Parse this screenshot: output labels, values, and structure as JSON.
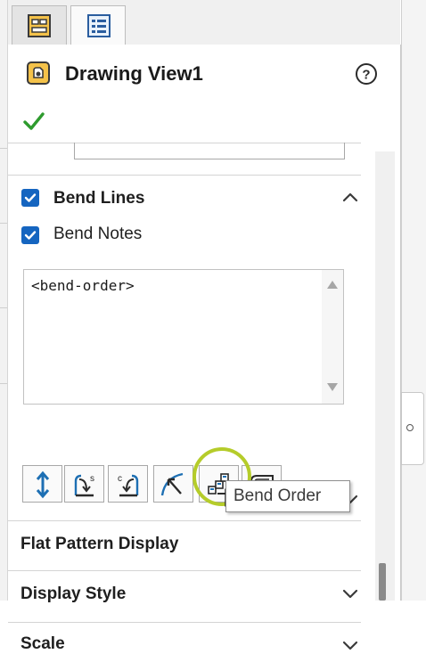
{
  "panel": {
    "title": "Drawing View1",
    "help_icon": "question-icon",
    "ok_icon": "checkmark-icon"
  },
  "tabs": [
    {
      "icon": "property-manager-icon"
    },
    {
      "icon": "feature-tree-icon"
    }
  ],
  "bend_lines": {
    "label": "Bend Lines",
    "checked": true,
    "bend_notes_label": "Bend Notes",
    "bend_notes_checked": true,
    "notes_text": "<bend-order>",
    "buttons": [
      {
        "icon": "vertical-arrows-icon"
      },
      {
        "icon": "bend-direction-s-icon"
      },
      {
        "icon": "bend-direction-c-icon"
      },
      {
        "icon": "bend-angle-icon"
      },
      {
        "icon": "bend-order-icon"
      },
      {
        "icon": "bend-table-icon"
      }
    ]
  },
  "tooltip": {
    "text": "Bend Order"
  },
  "sections": {
    "flat_pattern": "Flat Pattern Display",
    "display_style": "Display Style",
    "scale_partial": "Scale"
  },
  "colors": {
    "accent": "#1565c0",
    "highlight_ring": "#b5cc2a",
    "ok_green": "#2e9b2e"
  }
}
